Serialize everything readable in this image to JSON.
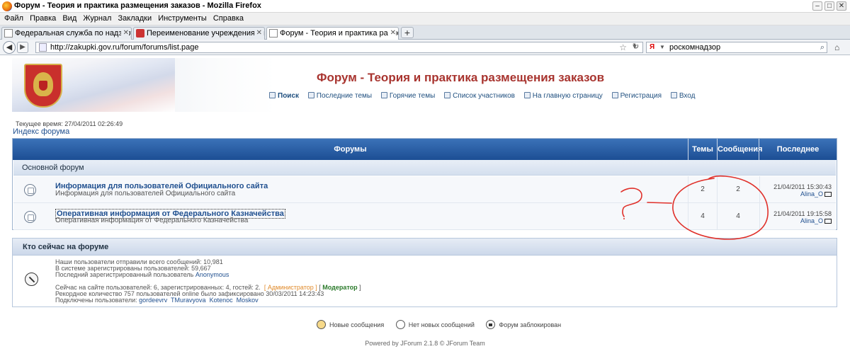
{
  "window": {
    "title": "Форум - Теория и практика размещения заказов - Mozilla Firefox"
  },
  "menu": [
    "Файл",
    "Правка",
    "Вид",
    "Журнал",
    "Закладки",
    "Инструменты",
    "Справка"
  ],
  "tabs": [
    {
      "label": "Федеральная служба по надзору в сф...",
      "icon": "document-icon"
    },
    {
      "label": "Переименование учреждения и госзак...",
      "icon": "gerb-icon"
    },
    {
      "label": "Форум - Теория и практика размещен...",
      "icon": "document-icon",
      "active": true
    }
  ],
  "url": "http://zakupki.gov.ru/forum/forums/list.page",
  "search": {
    "engine": "Яндекс",
    "value": "роскомнадзор"
  },
  "forum": {
    "title": "Форум - Теория и практика размещения заказов",
    "nav": [
      "Поиск",
      "Последние темы",
      "Горячие темы",
      "Список участников",
      "На главную страницу",
      "Регистрация",
      "Вход"
    ],
    "current_time": "Текущее время: 27/04/2011 02:26:49",
    "index_link": "Индекс форума",
    "table_headers": {
      "forums": "Форумы",
      "topics": "Темы",
      "messages": "Сообщения",
      "last": "Последнее сообщение"
    },
    "category": "Основной форум",
    "rows": [
      {
        "name": "Информация для пользователей Официального сайта",
        "desc": "Информация для пользователей Официального сайта",
        "topics": "2",
        "messages": "2",
        "last_date": "21/04/2011 15:30:43",
        "last_user": "Alina_O"
      },
      {
        "name": "Оперативная информация от Федерального Казначейства",
        "desc": "Оперативная информация от Федерального Казначейства",
        "topics": "4",
        "messages": "4",
        "last_date": "21/04/2011 19:15:58",
        "last_user": "Alina_O"
      }
    ],
    "online": {
      "title": "Кто сейчас на форуме",
      "line1": "Наши пользователи отправили всего сообщений: 10,981",
      "line2": "В системе зарегистрированы пользователей: 59,667",
      "line3_prefix": "Последний зарегистрированный пользователь",
      "line3_user": "Anonymous",
      "line4_prefix": "Сейчас на сайте пользователей: 6, зарегистрированных: 4, гостей: 2.",
      "admin_label": "[ Администратор ]",
      "mod_label": "Модератор",
      "line5": "Рекордное количество 757 пользователей online было зафиксировано 30/03/2011 14:23:43",
      "line6_prefix": "Подключены пользователи:",
      "users": [
        "gordeevrv",
        "TMuravyova",
        "Kotenoc",
        "Moskov"
      ]
    },
    "legend": {
      "new": "Новые сообщения",
      "nonew": "Нет новых сообщений",
      "locked": "Форум заблокирован"
    },
    "powered": "Powered by JForum 2.1.8 © JForum Team"
  },
  "colors": {
    "title": "#a8342f",
    "header_blue": "#1c4e94",
    "link": "#1f4f8f",
    "annotation": "#e0302a"
  }
}
